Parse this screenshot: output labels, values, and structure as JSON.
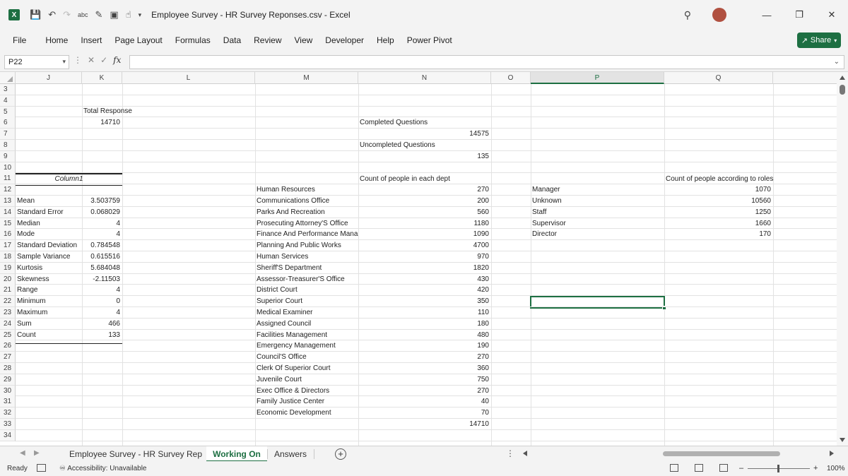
{
  "window": {
    "title": "Employee Survey - HR Survey Reponses.csv  -  Excel"
  },
  "menu": [
    "File",
    "Home",
    "Insert",
    "Page Layout",
    "Formulas",
    "Data",
    "Review",
    "View",
    "Developer",
    "Help",
    "Power Pivot"
  ],
  "share_label": "Share",
  "formula_bar": {
    "name_box": "P22",
    "fx": "fx",
    "value": ""
  },
  "columns": [
    "J",
    "K",
    "L",
    "M",
    "N",
    "O",
    "P",
    "Q"
  ],
  "active_column": "P",
  "rows": [
    "3",
    "4",
    "5",
    "6",
    "7",
    "8",
    "9",
    "10",
    "11",
    "12",
    "13",
    "14",
    "15",
    "16",
    "17",
    "18",
    "19",
    "20",
    "21",
    "22",
    "23",
    "24",
    "25",
    "26",
    "27",
    "28",
    "29",
    "30",
    "31",
    "32",
    "33",
    "34"
  ],
  "summary": {
    "total_response_label": "Total Response",
    "total_response_value": "14710",
    "completed_label": "Completed Questions",
    "completed_value": "14575",
    "uncompleted_label": "Uncompleted Questions",
    "uncompleted_value": "135"
  },
  "stats": {
    "header": "Column1",
    "rows": [
      {
        "label": "Mean",
        "value": "3.503759"
      },
      {
        "label": "Standard Error",
        "value": "0.068029"
      },
      {
        "label": "Median",
        "value": "4"
      },
      {
        "label": "Mode",
        "value": "4"
      },
      {
        "label": "Standard Deviation",
        "value": "0.784548"
      },
      {
        "label": "Sample Variance",
        "value": "0.615516"
      },
      {
        "label": "Kurtosis",
        "value": "5.684048"
      },
      {
        "label": "Skewness",
        "value": "-2.11503"
      },
      {
        "label": "Range",
        "value": "4"
      },
      {
        "label": "Minimum",
        "value": "0"
      },
      {
        "label": "Maximum",
        "value": "4"
      },
      {
        "label": "Sum",
        "value": "466"
      },
      {
        "label": "Count",
        "value": "133"
      }
    ]
  },
  "departments": {
    "header": "Count of people in each dept",
    "rows": [
      {
        "name": "Human Resources",
        "count": "270"
      },
      {
        "name": "Communications Office",
        "count": "200"
      },
      {
        "name": "Parks And Recreation",
        "count": "560"
      },
      {
        "name": "Prosecuting Attorney'S Office",
        "count": "1180"
      },
      {
        "name": "Finance And Performance Mana",
        "count": "1090"
      },
      {
        "name": "Planning And Public Works",
        "count": "4700"
      },
      {
        "name": "Human Services",
        "count": "970"
      },
      {
        "name": "Sheriff'S Department",
        "count": "1820"
      },
      {
        "name": "Assessor-Treasurer'S Office",
        "count": "430"
      },
      {
        "name": "District Court",
        "count": "420"
      },
      {
        "name": "Superior Court",
        "count": "350"
      },
      {
        "name": "Medical Examiner",
        "count": "110"
      },
      {
        "name": "Assigned Council",
        "count": "180"
      },
      {
        "name": "Facilities Management",
        "count": "480"
      },
      {
        "name": "Emergency Management",
        "count": "190"
      },
      {
        "name": "Council'S Office",
        "count": "270"
      },
      {
        "name": "Clerk Of Superior Court",
        "count": "360"
      },
      {
        "name": "Juvenile Court",
        "count": "750"
      },
      {
        "name": "Exec Office & Directors",
        "count": "270"
      },
      {
        "name": "Family Justice Center",
        "count": "40"
      },
      {
        "name": "Economic Development",
        "count": "70"
      }
    ],
    "total": "14710"
  },
  "roles": {
    "header": "Count of people according to roles",
    "rows": [
      {
        "name": "Manager",
        "count": "1070"
      },
      {
        "name": "Unknown",
        "count": "10560"
      },
      {
        "name": "Staff",
        "count": "1250"
      },
      {
        "name": "Supervisor",
        "count": "1660"
      },
      {
        "name": "Director",
        "count": "170"
      }
    ]
  },
  "sheets": [
    "Employee Survey - HR Survey Rep",
    "Working On",
    "Answers"
  ],
  "active_sheet": "Working On",
  "status": {
    "ready": "Ready",
    "accessibility": "Accessibility: Unavailable",
    "zoom": "100%"
  }
}
